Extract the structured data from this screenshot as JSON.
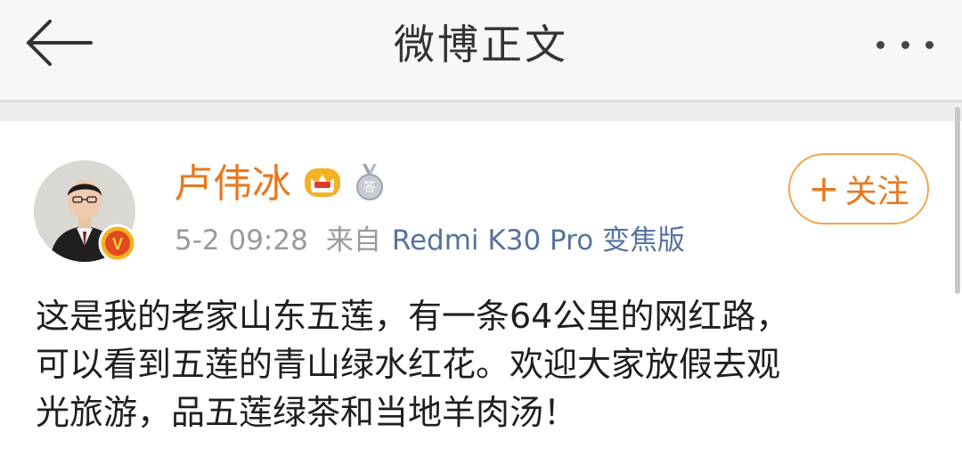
{
  "nav": {
    "title": "微博正文"
  },
  "post": {
    "user_name": "卢伟冰",
    "follow_label": "关注",
    "follow_plus": "+",
    "time": "5-2 09:28",
    "source_label": "来自",
    "device": "Redmi K30 Pro 变焦版",
    "text_lines": [
      "这是我的老家山东五莲，有一条64公里的网红路，",
      "可以看到五莲的青山绿水红花。欢迎大家放假去观",
      "光旅游，品五莲绿茶和当地羊肉汤！"
    ],
    "badges": {
      "verified": "verified-v-icon",
      "crown": "crown-icon",
      "medal": "medal-icon",
      "verified_letter": "V",
      "medal_letter": "答"
    }
  },
  "colors": {
    "accent": "#e8781f",
    "link": "#56739c",
    "meta": "#9a9a9a",
    "text": "#1f1f1f",
    "nav_bg": "#f7f7f7"
  }
}
